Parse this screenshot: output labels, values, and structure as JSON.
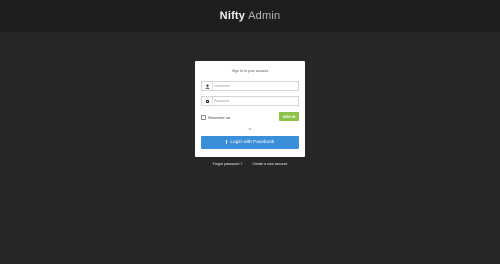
{
  "header": {
    "brand_bold": "Nifty",
    "brand_light": "Admin"
  },
  "login": {
    "title": "Sign In to your account",
    "username_placeholder": "Username",
    "password_placeholder": "Password",
    "username_icon": "user-icon",
    "password_icon": "lock-icon",
    "remember_label": "Remember me",
    "remember_checked": false,
    "signin_label": "SIGN IN",
    "or_label": "- or -",
    "facebook_icon": "facebook-icon",
    "facebook_label": "Login with Facebook"
  },
  "footer_links": {
    "forgot": "Forgot password ?",
    "create": "Create a new account"
  },
  "colors": {
    "background": "#262629",
    "topbar": "#1e1e20",
    "signin_button": "#8bc34a",
    "facebook_button": "#3b8ed8"
  }
}
